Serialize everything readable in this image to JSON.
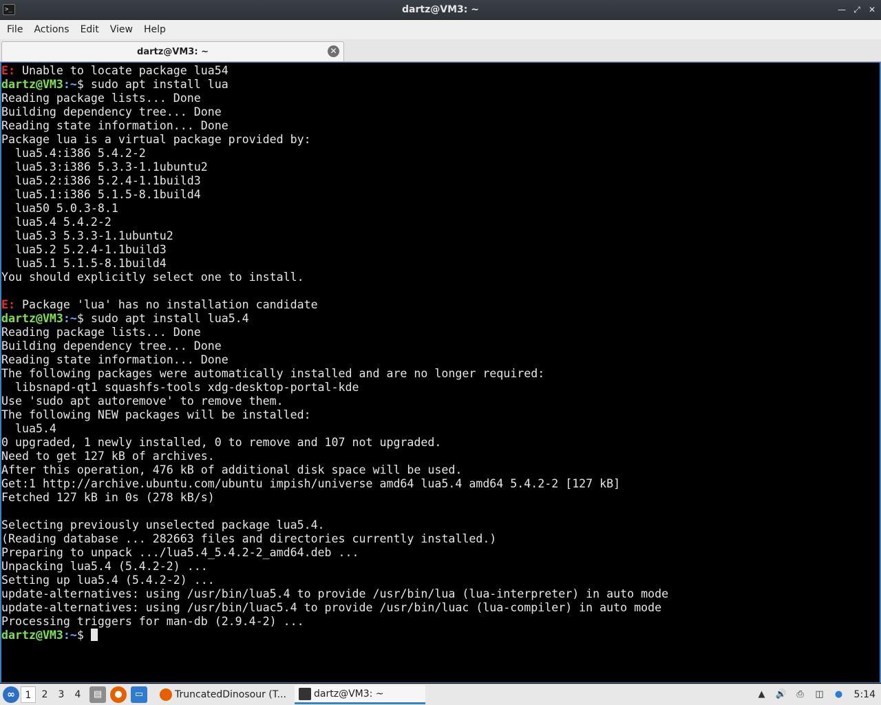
{
  "window": {
    "title": "dartz@VM3: ~"
  },
  "menu": [
    "File",
    "Actions",
    "Edit",
    "View",
    "Help"
  ],
  "tab": {
    "label": "dartz@VM3: ~"
  },
  "terminal": {
    "prompt_user": "dartz@VM3",
    "prompt_path": ":~",
    "prompt_symbol": "$",
    "lines": [
      [
        [
          "err",
          "E:"
        ],
        [
          "txt",
          " Unable to locate package lua54"
        ]
      ],
      [
        [
          "pu",
          "dartz@VM3"
        ],
        [
          "pp",
          ":~"
        ],
        [
          "txt",
          "$ sudo apt install lua"
        ]
      ],
      [
        [
          "txt",
          "Reading package lists... Done"
        ]
      ],
      [
        [
          "txt",
          "Building dependency tree... Done"
        ]
      ],
      [
        [
          "txt",
          "Reading state information... Done"
        ]
      ],
      [
        [
          "txt",
          "Package lua is a virtual package provided by:"
        ]
      ],
      [
        [
          "txt",
          "  lua5.4:i386 5.4.2-2"
        ]
      ],
      [
        [
          "txt",
          "  lua5.3:i386 5.3.3-1.1ubuntu2"
        ]
      ],
      [
        [
          "txt",
          "  lua5.2:i386 5.2.4-1.1build3"
        ]
      ],
      [
        [
          "txt",
          "  lua5.1:i386 5.1.5-8.1build4"
        ]
      ],
      [
        [
          "txt",
          "  lua50 5.0.3-8.1"
        ]
      ],
      [
        [
          "txt",
          "  lua5.4 5.4.2-2"
        ]
      ],
      [
        [
          "txt",
          "  lua5.3 5.3.3-1.1ubuntu2"
        ]
      ],
      [
        [
          "txt",
          "  lua5.2 5.2.4-1.1build3"
        ]
      ],
      [
        [
          "txt",
          "  lua5.1 5.1.5-8.1build4"
        ]
      ],
      [
        [
          "txt",
          "You should explicitly select one to install."
        ]
      ],
      [
        [
          "txt",
          ""
        ]
      ],
      [
        [
          "err",
          "E:"
        ],
        [
          "txt",
          " Package 'lua' has no installation candidate"
        ]
      ],
      [
        [
          "pu",
          "dartz@VM3"
        ],
        [
          "pp",
          ":~"
        ],
        [
          "txt",
          "$ sudo apt install lua5.4"
        ]
      ],
      [
        [
          "txt",
          "Reading package lists... Done"
        ]
      ],
      [
        [
          "txt",
          "Building dependency tree... Done"
        ]
      ],
      [
        [
          "txt",
          "Reading state information... Done"
        ]
      ],
      [
        [
          "txt",
          "The following packages were automatically installed and are no longer required:"
        ]
      ],
      [
        [
          "txt",
          "  libsnapd-qt1 squashfs-tools xdg-desktop-portal-kde"
        ]
      ],
      [
        [
          "txt",
          "Use 'sudo apt autoremove' to remove them."
        ]
      ],
      [
        [
          "txt",
          "The following NEW packages will be installed:"
        ]
      ],
      [
        [
          "txt",
          "  lua5.4"
        ]
      ],
      [
        [
          "txt",
          "0 upgraded, 1 newly installed, 0 to remove and 107 not upgraded."
        ]
      ],
      [
        [
          "txt",
          "Need to get 127 kB of archives."
        ]
      ],
      [
        [
          "txt",
          "After this operation, 476 kB of additional disk space will be used."
        ]
      ],
      [
        [
          "txt",
          "Get:1 http://archive.ubuntu.com/ubuntu impish/universe amd64 lua5.4 amd64 5.4.2-2 [127 kB]"
        ]
      ],
      [
        [
          "txt",
          "Fetched 127 kB in 0s (278 kB/s)"
        ]
      ],
      [
        [
          "txt",
          ""
        ]
      ],
      [
        [
          "txt",
          "Selecting previously unselected package lua5.4."
        ]
      ],
      [
        [
          "txt",
          "(Reading database ... 282663 files and directories currently installed.)"
        ]
      ],
      [
        [
          "txt",
          "Preparing to unpack .../lua5.4_5.4.2-2_amd64.deb ..."
        ]
      ],
      [
        [
          "txt",
          "Unpacking lua5.4 (5.4.2-2) ..."
        ]
      ],
      [
        [
          "txt",
          "Setting up lua5.4 (5.4.2-2) ..."
        ]
      ],
      [
        [
          "txt",
          "update-alternatives: using /usr/bin/lua5.4 to provide /usr/bin/lua (lua-interpreter) in auto mode"
        ]
      ],
      [
        [
          "txt",
          "update-alternatives: using /usr/bin/luac5.4 to provide /usr/bin/luac (lua-compiler) in auto mode"
        ]
      ],
      [
        [
          "txt",
          "Processing triggers for man-db (2.9.4-2) ..."
        ]
      ]
    ]
  },
  "taskbar": {
    "workspaces": [
      "1",
      "2",
      "3",
      "4"
    ],
    "active_workspace": "1",
    "tasks": [
      {
        "label": "TruncatedDinosour (T...",
        "icon": "firefox-icon"
      },
      {
        "label": "dartz@VM3: ~",
        "icon": "terminal-icon"
      }
    ],
    "clock": "5:14"
  },
  "colors": {
    "prompt_user": "#7ee24a",
    "prompt_path": "#6fa7ff",
    "error": "#ef2929",
    "terminal_bg": "#000000",
    "terminal_fg": "#e6e6e6",
    "accent": "#3a82c4"
  }
}
